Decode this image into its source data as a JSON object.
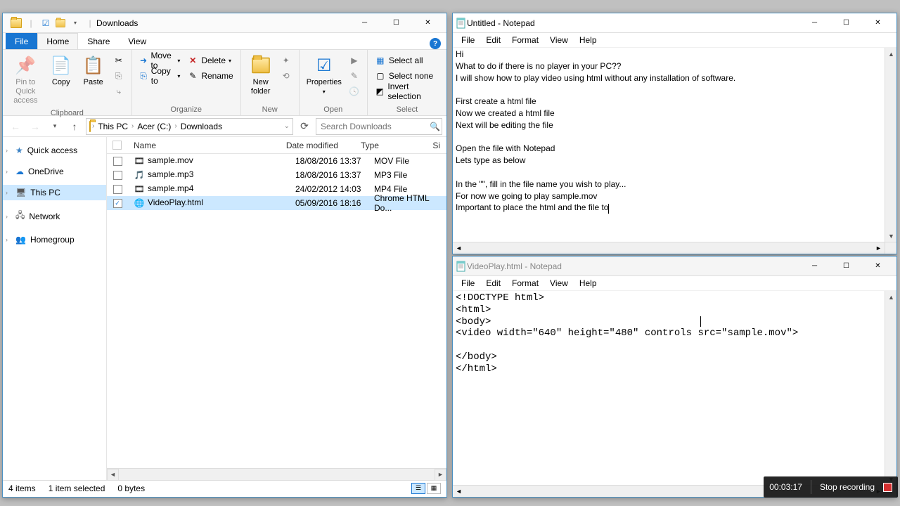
{
  "explorer": {
    "title": "Downloads",
    "tabs": {
      "file": "File",
      "home": "Home",
      "share": "Share",
      "view": "View"
    },
    "ribbon": {
      "clipboard": {
        "label": "Clipboard",
        "pin": "Pin to Quick\naccess",
        "copy": "Copy",
        "paste": "Paste",
        "cut": "Cut",
        "copy_path": "Copy path",
        "paste_shortcut": "Paste shortcut"
      },
      "organize": {
        "label": "Organize",
        "move": "Move to",
        "copy": "Copy to",
        "delete": "Delete",
        "rename": "Rename"
      },
      "new": {
        "label": "New",
        "newfolder": "New\nfolder",
        "newitem": "New item",
        "easyaccess": "Easy access"
      },
      "open": {
        "label": "Open",
        "properties": "Properties",
        "open": "Open",
        "edit": "Edit",
        "history": "History"
      },
      "select": {
        "label": "Select",
        "all": "Select all",
        "none": "Select none",
        "invert": "Invert selection"
      }
    },
    "breadcrumb": [
      "This PC",
      "Acer (C:)",
      "Downloads"
    ],
    "search_placeholder": "Search Downloads",
    "nav": [
      {
        "label": "Quick access",
        "icon": "star"
      },
      {
        "label": "OneDrive",
        "icon": "cloud"
      },
      {
        "label": "This PC",
        "icon": "pc",
        "selected": true
      },
      {
        "label": "Network",
        "icon": "network"
      },
      {
        "label": "Homegroup",
        "icon": "homegroup"
      }
    ],
    "columns": {
      "name": "Name",
      "date": "Date modified",
      "type": "Type",
      "size": "Si"
    },
    "files": [
      {
        "name": "sample.mov",
        "date": "18/08/2016 13:37",
        "type": "MOV File",
        "icon": "video",
        "checked": false
      },
      {
        "name": "sample.mp3",
        "date": "18/08/2016 13:37",
        "type": "MP3 File",
        "icon": "audio",
        "checked": false
      },
      {
        "name": "sample.mp4",
        "date": "24/02/2012 14:03",
        "type": "MP4 File",
        "icon": "video",
        "checked": false
      },
      {
        "name": "VideoPlay.html",
        "date": "05/09/2016 18:16",
        "type": "Chrome HTML Do...",
        "icon": "chrome",
        "checked": true
      }
    ],
    "status": {
      "count": "4 items",
      "selected": "1 item selected",
      "size": "0 bytes"
    }
  },
  "notepad1": {
    "title": "Untitled - Notepad",
    "menu": [
      "File",
      "Edit",
      "Format",
      "View",
      "Help"
    ],
    "text": "Hi\nWhat to do if there is no player in your PC??\nI will show how to play video using html without any installation of software.\n\nFirst create a html file\nNow we created a html file\nNext will be editing the file\n\nOpen the file with Notepad\nLets type as below\n\nIn the \"\", fill in the file name you wish to play...\nFor now we going to play sample.mov\nImportant to place the html and the file to"
  },
  "notepad2": {
    "title": "VideoPlay.html - Notepad",
    "menu": [
      "File",
      "Edit",
      "Format",
      "View",
      "Help"
    ],
    "text": "<!DOCTYPE html>\n<html>\n<body>\n<video width=\"640\" height=\"480\" controls src=\"sample.mov\">\n\n</body>\n</html>"
  },
  "recording": {
    "time": "00:03:17",
    "stop": "Stop recording"
  }
}
